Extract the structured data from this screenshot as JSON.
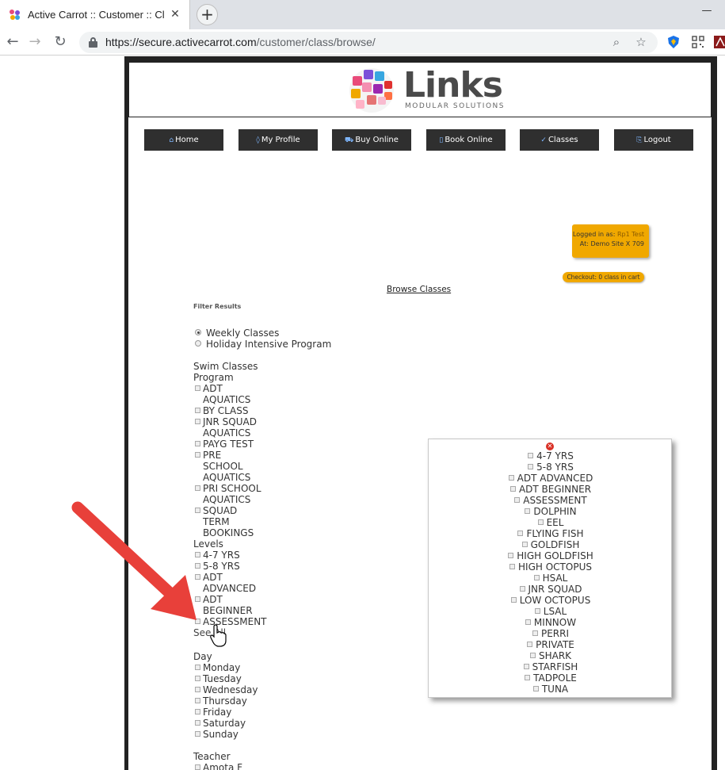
{
  "browser": {
    "tab_title": "Active Carrot :: Customer :: Class",
    "url_host": "https://secure.activecarrot.com",
    "url_path": "/customer/class/browse/"
  },
  "header": {
    "logo_word": "Links",
    "logo_sub": "MODULAR SOLUTIONS"
  },
  "nav": [
    {
      "label": "Home",
      "icon": "home-icon"
    },
    {
      "label": "My Profile",
      "icon": "profile-icon"
    },
    {
      "label": "Buy Online",
      "icon": "cart-icon"
    },
    {
      "label": "Book Online",
      "icon": "book-icon"
    },
    {
      "label": "Classes",
      "icon": "classes-icon"
    },
    {
      "label": "Logout",
      "icon": "logout-icon"
    }
  ],
  "session": {
    "logged_in_label": "Logged in as:",
    "logged_in_user": "Rp1 Test",
    "site_line": "At: Demo Site X 709",
    "checkout": "Checkout: 0 class in cart"
  },
  "page_title": "Browse Classes",
  "filter": {
    "title": "Filter Results",
    "options": [
      "Weekly Classes",
      "Holiday Intensive Program"
    ],
    "selected_index": 0
  },
  "program": {
    "heading_1": "Swim Classes",
    "heading_2": "Program",
    "items": [
      "ADT AQUATICS",
      "BY CLASS",
      "JNR SQUAD AQUATICS",
      "PAYG TEST",
      "PRE SCHOOL AQUATICS",
      "PRI SCHOOL AQUATICS",
      "SQUAD TERM BOOKINGS"
    ]
  },
  "levels": {
    "heading": "Levels",
    "items": [
      "4-7 YRS",
      "5-8 YRS",
      "ADT ADVANCED",
      "ADT BEGINNER",
      "ASSESSMENT"
    ],
    "see_all": "See All"
  },
  "day": {
    "heading": "Day",
    "items": [
      "Monday",
      "Tuesday",
      "Wednesday",
      "Thursday",
      "Friday",
      "Saturday",
      "Sunday"
    ]
  },
  "teacher": {
    "heading": "Teacher",
    "items": [
      "Amota F"
    ]
  },
  "popup": {
    "items": [
      "4-7 YRS",
      "5-8 YRS",
      "ADT ADVANCED",
      "ADT BEGINNER",
      "ASSESSMENT",
      "DOLPHIN",
      "EEL",
      "FLYING FISH",
      "GOLDFISH",
      "HIGH GOLDFISH",
      "HIGH OCTOPUS",
      "HSAL",
      "JNR SQUAD",
      "LOW OCTOPUS",
      "LSAL",
      "MINNOW",
      "PERRI",
      "PRIVATE",
      "SHARK",
      "STARFISH",
      "TADPOLE",
      "TUNA"
    ]
  },
  "colors": {
    "nav_bg": "#2f2f2f",
    "badge_orange": "#f0a800",
    "arrow_red": "#e8403a"
  }
}
